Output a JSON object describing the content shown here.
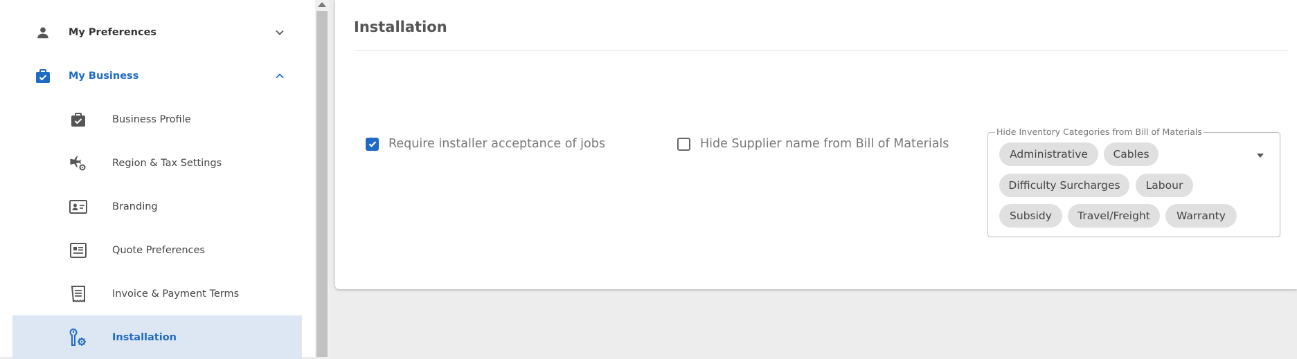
{
  "sidebar": {
    "sections": [
      {
        "label": "My Preferences",
        "icon": "person-icon",
        "state": "collapsed"
      },
      {
        "label": "My Business",
        "icon": "business-check-icon",
        "state": "expanded"
      }
    ],
    "items": [
      {
        "label": "Business Profile",
        "icon": "briefcase-check-icon"
      },
      {
        "label": "Region & Tax Settings",
        "icon": "flight-settings-icon"
      },
      {
        "label": "Branding",
        "icon": "id-card-icon"
      },
      {
        "label": "Quote Preferences",
        "icon": "quote-list-icon"
      },
      {
        "label": "Invoice & Payment Terms",
        "icon": "receipt-icon"
      },
      {
        "label": "Installation",
        "icon": "wrench-gear-icon",
        "active": true
      }
    ]
  },
  "main": {
    "title": "Installation",
    "options": [
      {
        "label": "Require installer acceptance of jobs",
        "checked": true
      },
      {
        "label": "Hide Supplier name from Bill of Materials",
        "checked": false
      }
    ],
    "hide_categories": {
      "legend": "Hide Inventory Categories from Bill of Materials",
      "chips": [
        "Administrative",
        "Cables",
        "Difficulty Surcharges",
        "Labour",
        "Subsidy",
        "Travel/Freight",
        "Warranty"
      ]
    }
  },
  "colors": {
    "accent": "#1f6bc4",
    "active_bg": "#dde7f3",
    "chip_bg": "#e0e0e0",
    "page_bg": "#ededed"
  }
}
